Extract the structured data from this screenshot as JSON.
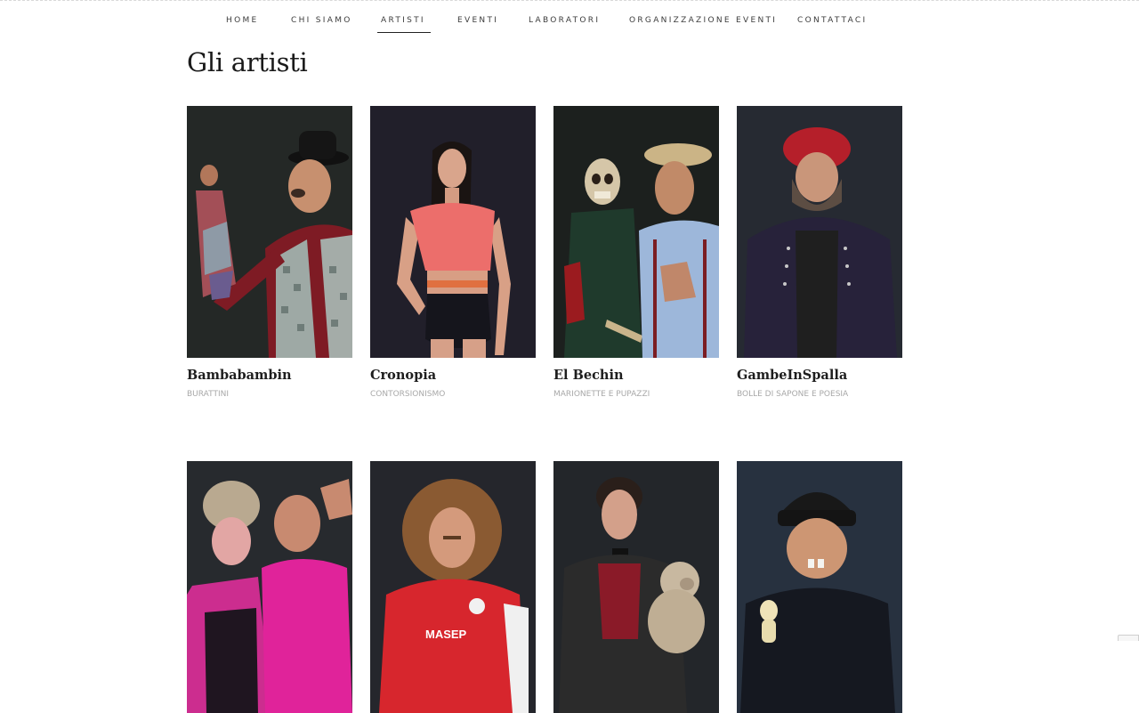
{
  "nav": {
    "items": [
      {
        "label": "HOME",
        "active": false
      },
      {
        "label": "CHI SIAMO",
        "active": false
      },
      {
        "label": "ARTISTI",
        "active": true
      },
      {
        "label": "EVENTI",
        "active": false
      },
      {
        "label": "LABORATORI",
        "active": false
      },
      {
        "label": "ORGANIZZAZIONE EVENTI",
        "active": false
      },
      {
        "label": "CONTATTACI",
        "active": false
      }
    ]
  },
  "page": {
    "title": "Gli artisti"
  },
  "artists": [
    {
      "name": "Bambabambin",
      "category": "BURATTINI"
    },
    {
      "name": "Cronopia",
      "category": "CONTORSIONISMO"
    },
    {
      "name": "El Bechin",
      "category": "MARIONETTE E PUPAZZI"
    },
    {
      "name": "GambeInSpalla",
      "category": "BOLLE DI SAPONE E POESIA"
    },
    {
      "name": "",
      "category": ""
    },
    {
      "name": "",
      "category": ""
    },
    {
      "name": "",
      "category": ""
    },
    {
      "name": "",
      "category": ""
    }
  ],
  "photo_captions": {
    "masep": "MASEP"
  },
  "colors": {
    "nav_text": "#3b3b3b",
    "title": "#1a1a1a",
    "category": "#a8a8a8",
    "photo_bg_dark": "#1f2024"
  }
}
